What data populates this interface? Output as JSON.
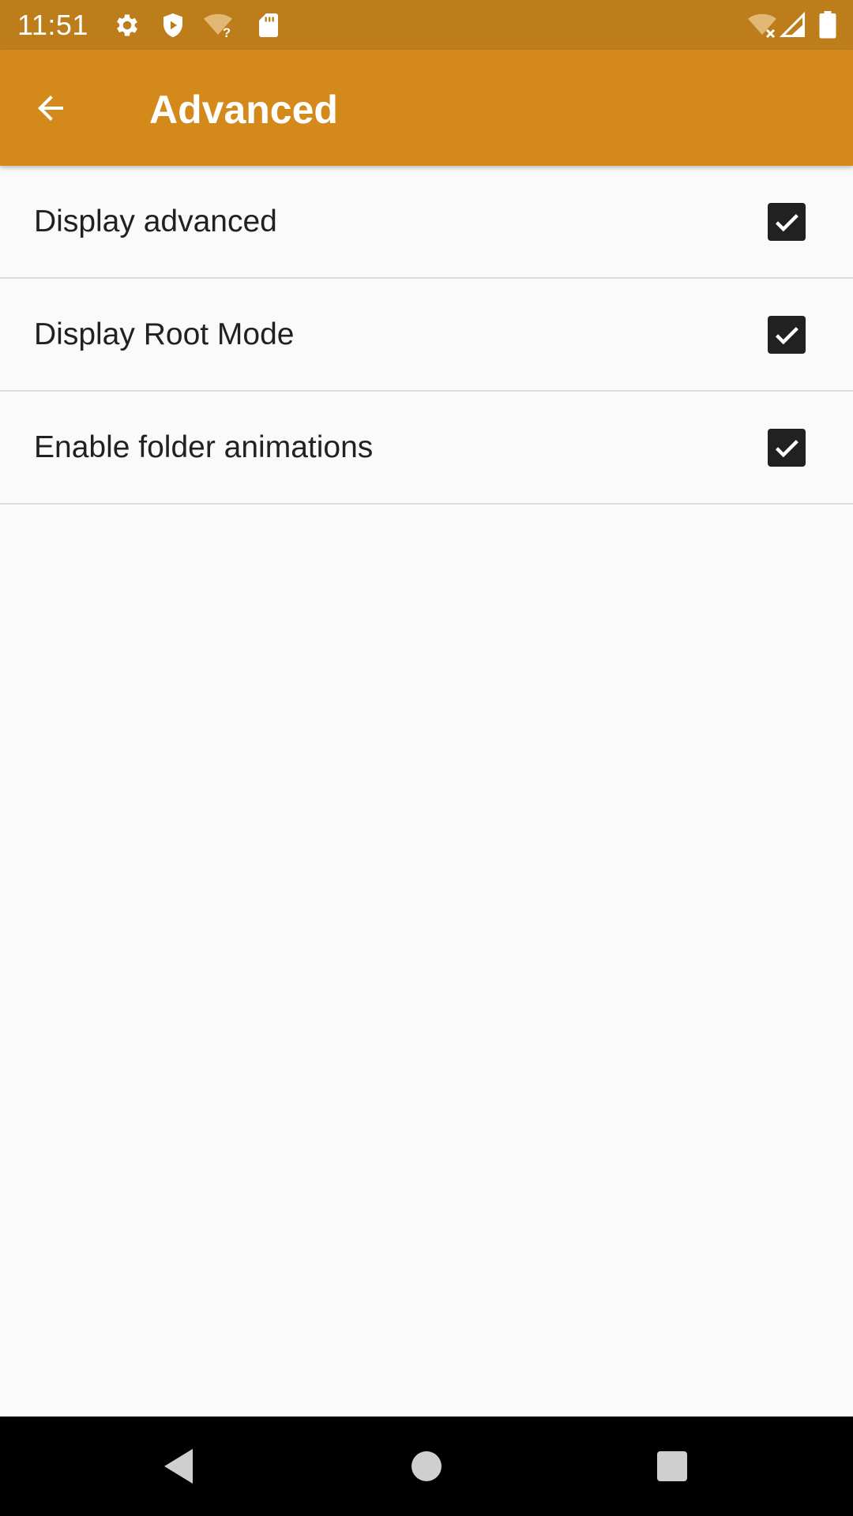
{
  "status_bar": {
    "time": "11:51",
    "color": "#bd7d1a",
    "icons": [
      "settings-gear-icon",
      "shield-play-icon",
      "wifi-question-icon",
      "sd-card-icon",
      "wifi-x-icon",
      "cell-signal-icon",
      "battery-icon"
    ]
  },
  "app_bar": {
    "title": "Advanced",
    "back_icon": "arrow-left-icon",
    "color": "#d48a1a"
  },
  "preferences": [
    {
      "label": "Display advanced",
      "checked": true
    },
    {
      "label": "Display Root Mode",
      "checked": true
    },
    {
      "label": "Enable folder animations",
      "checked": true
    }
  ],
  "nav_bar": {
    "buttons": [
      "back-triangle-icon",
      "home-circle-icon",
      "recents-square-icon"
    ]
  }
}
